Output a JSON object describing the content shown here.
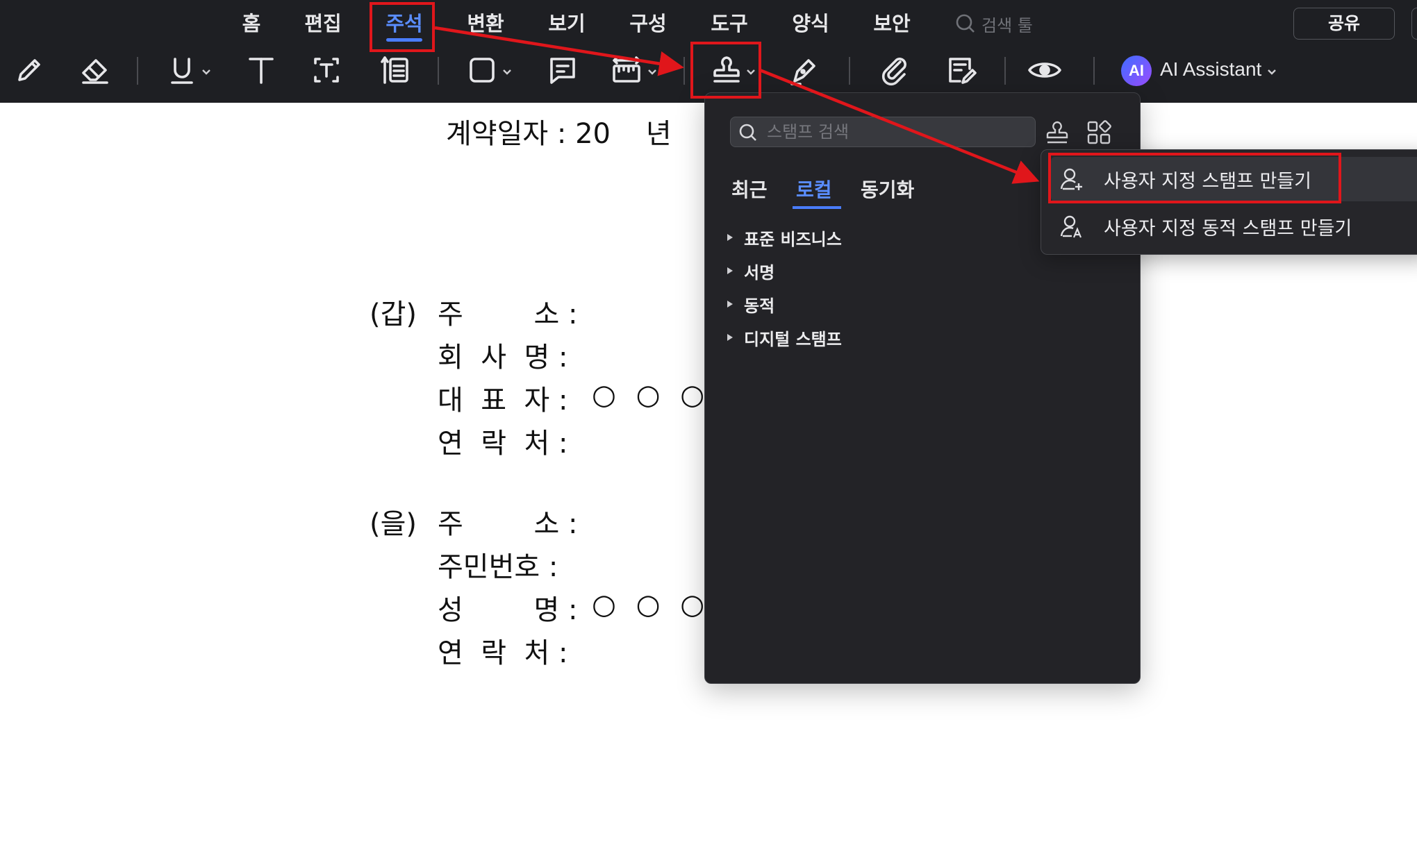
{
  "menu": {
    "items": [
      {
        "label": "홈"
      },
      {
        "label": "편집"
      },
      {
        "label": "주석"
      },
      {
        "label": "변환"
      },
      {
        "label": "보기"
      },
      {
        "label": "구성"
      },
      {
        "label": "도구"
      },
      {
        "label": "양식"
      },
      {
        "label": "보안"
      }
    ],
    "active": "주석",
    "search_placeholder": "검색 툴",
    "share_label": "공유"
  },
  "toolbar": {
    "tools": [
      "pencil-icon",
      "eraser-icon",
      "underline-icon",
      "text-icon",
      "textbox-icon",
      "callout-icon",
      "shape-icon",
      "comment-icon",
      "measure-icon",
      "stamp-icon",
      "signature-icon",
      "attachment-icon",
      "form-sign-icon",
      "view-icon"
    ],
    "ai_badge": "AI",
    "ai_label": "AI Assistant"
  },
  "document": {
    "contract_date": "계약일자 : 20    년",
    "party_a_label": "(갑)",
    "party_a_rows": [
      "주        소 :",
      "회  사  명 :",
      "대  표  자 :",
      "연  락  처 :"
    ],
    "party_b_label": "(을)",
    "party_b_rows": [
      "주        소 :",
      "주민번호 :",
      "성        명 :",
      "연  락  처 :"
    ],
    "signature_placeholder": "○ ○ ○"
  },
  "stamp_panel": {
    "search_placeholder": "스탬프 검색",
    "tabs": [
      {
        "label": "최근"
      },
      {
        "label": "로컬"
      },
      {
        "label": "동기화"
      }
    ],
    "active_tab": "로컬",
    "categories": [
      {
        "label": "표준 비즈니스"
      },
      {
        "label": "서명"
      },
      {
        "label": "동적"
      },
      {
        "label": "디지털 스탬프"
      }
    ]
  },
  "stamp_submenu": {
    "items": [
      {
        "label": "사용자 지정 스탬프 만들기"
      },
      {
        "label": "사용자 지정 동적 스탬프 만들기"
      }
    ]
  },
  "colors": {
    "topbar": "#1e1f23",
    "accent": "#4a7dff",
    "highlight": "#e0161b"
  }
}
